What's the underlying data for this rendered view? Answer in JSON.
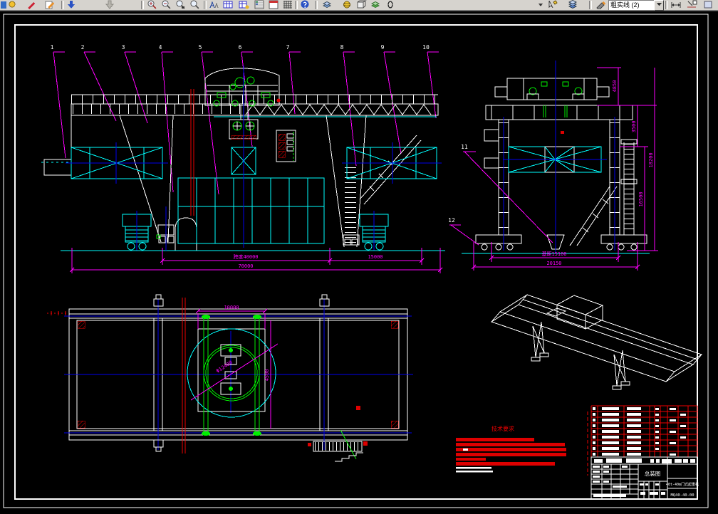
{
  "app": {
    "canvas_bg": "#000000",
    "toolbar_bg": "#d6d3ce"
  },
  "toolbar": {
    "layer_combo_value": "粗实线 (2)",
    "icons": [
      "document",
      "render-sun",
      "redline-pencil",
      "edit-page",
      "move-down",
      "move-down-disabled",
      "zoom-in",
      "zoom-out",
      "zoom-window",
      "zoom-previous",
      "find-text",
      "table",
      "table-properties",
      "layer-list",
      "window-red",
      "grid",
      "help",
      "iso-view",
      "sphere",
      "cube",
      "layer-green",
      "zero-display",
      "dropdown-arrow",
      "select-sketch",
      "layers-blue",
      "draft-pencil",
      "dim-style",
      "dim-edit"
    ]
  },
  "drawing": {
    "colors": {
      "line": "#ffffff",
      "aux": "#00ffff",
      "dim": "#ff00ff",
      "center": "#0000ee",
      "detail": "#00ee00",
      "alert": "#ee0000"
    },
    "callouts": [
      "1",
      "2",
      "3",
      "4",
      "5",
      "6",
      "7",
      "8",
      "9",
      "10"
    ],
    "side_callouts": [
      "11",
      "12"
    ],
    "front_view": {
      "span_dim": "跨度40000",
      "cantilever_dim": "15000",
      "total_dim": "70000"
    },
    "side_view": {
      "trolley_height_dim": "4850",
      "rail_height_dim": "3500",
      "leg_height_dim": "16500",
      "total_height_dim": "18200",
      "gauge_dim": "基距15100",
      "base_dim": "20150"
    },
    "plan_view": {
      "trolley_gauge_dim": "10000",
      "slew_circle_dim": "Φ12400",
      "platform_dim": "4500"
    },
    "tech_requirements": {
      "title": "技术要求"
    },
    "title_block": {
      "view_label": "总装图",
      "product_name": "40t-40m门式起重机",
      "drawing_number": "MQ40-40-00"
    }
  }
}
